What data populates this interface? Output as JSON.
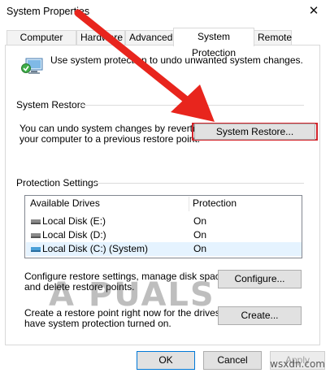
{
  "window": {
    "title": "System Properties",
    "close_glyph": "✕"
  },
  "tabs": [
    {
      "label": "Computer Name"
    },
    {
      "label": "Hardware"
    },
    {
      "label": "Advanced"
    },
    {
      "label": "System Protection"
    },
    {
      "label": "Remote"
    }
  ],
  "active_tab": "System Protection",
  "intro_text": "Use system protection to undo unwanted system changes.",
  "system_restore": {
    "heading": "System Restore",
    "description_line1": "You can undo system changes by reverting",
    "description_line2": "your computer to a previous restore point.",
    "button_label": "System Restore..."
  },
  "protection_settings": {
    "heading": "Protection Settings",
    "columns": [
      "Available Drives",
      "Protection"
    ],
    "rows": [
      {
        "drive": "Local Disk (E:)",
        "protection": "On",
        "icon": "drive-icon"
      },
      {
        "drive": "Local Disk (D:)",
        "protection": "On",
        "icon": "drive-icon"
      },
      {
        "drive": "Local Disk (C:) (System)",
        "protection": "On",
        "icon": "system-drive-icon"
      }
    ]
  },
  "configure": {
    "text_line1": "Configure restore settings, manage disk space,",
    "text_line2": "and delete restore points.",
    "button_label": "Configure..."
  },
  "create": {
    "text_line1": "Create a restore point right now for the drives that",
    "text_line2": "have system protection turned on.",
    "button_label": "Create..."
  },
  "footer": {
    "ok": "OK",
    "cancel": "Cancel",
    "apply": "Apply"
  },
  "watermark": "A  PUALS",
  "site_tag": "wsxdn.com",
  "colors": {
    "highlight_frame": "#d2232a",
    "arrow": "#e8251d",
    "selected_row": "#e5f3ff"
  }
}
